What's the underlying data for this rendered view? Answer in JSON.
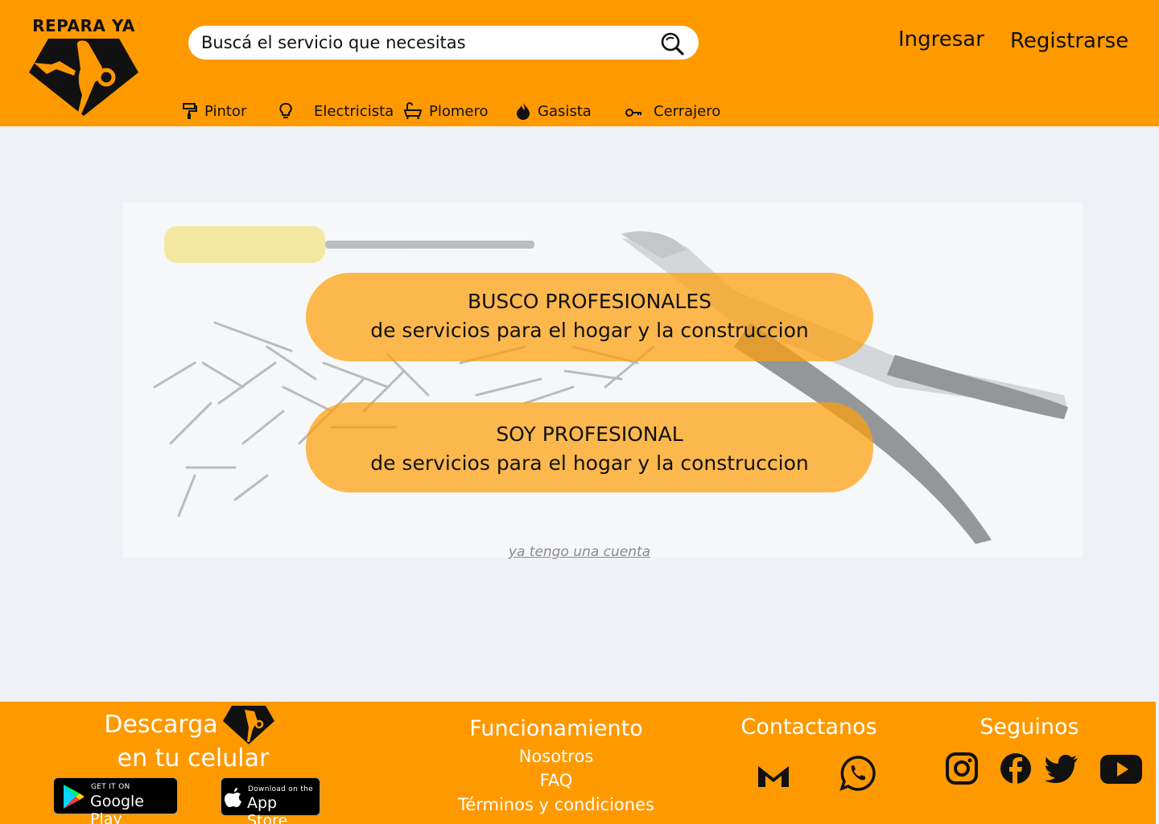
{
  "brand": {
    "name": "REPARA YA"
  },
  "search": {
    "placeholder": "Buscá el servicio que necesitas"
  },
  "auth": {
    "login": "Ingresar",
    "register": "Registrarse"
  },
  "categories": [
    {
      "label": "Pintor",
      "icon": "paint-roller-icon"
    },
    {
      "label": "Electricista",
      "icon": "lightbulb-icon"
    },
    {
      "label": "Plomero",
      "icon": "bathtub-icon"
    },
    {
      "label": "Gasista",
      "icon": "flame-icon"
    },
    {
      "label": "Cerrajero",
      "icon": "key-icon"
    }
  ],
  "hero": {
    "cta_client": {
      "line1": "BUSCO PROFESIONALES",
      "line2": "de servicios para el hogar y la construccion"
    },
    "cta_pro": {
      "line1": "SOY PROFESIONAL",
      "line2": "de servicios para el hogar y la construccion"
    },
    "account_link": "ya tengo una cuenta"
  },
  "footer": {
    "download": {
      "line1": "Descarga",
      "line2": "en tu celular"
    },
    "google_play": {
      "small": "GET IT ON",
      "big": "Google Play"
    },
    "app_store": {
      "small": "Download on the",
      "big": "App Store"
    },
    "info": {
      "title": "Funcionamiento",
      "links": [
        "Nosotros",
        "FAQ",
        "Términos y condiciones"
      ]
    },
    "contact": {
      "title": "Contactanos",
      "icons": [
        "gmail-icon",
        "whatsapp-icon"
      ]
    },
    "follow": {
      "title": "Seguinos",
      "icons": [
        "instagram-icon",
        "facebook-icon",
        "twitter-icon",
        "youtube-icon"
      ]
    }
  },
  "colors": {
    "brand_orange": "#ff9900",
    "page_bg": "#eef1f5",
    "cta_fill": "#ffa00a"
  }
}
